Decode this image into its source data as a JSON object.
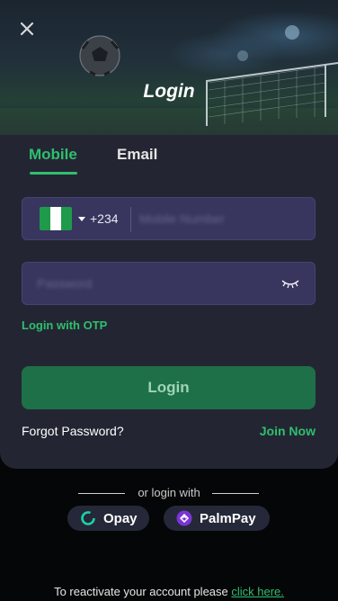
{
  "header": {
    "title": "Login",
    "close_icon": "close-icon"
  },
  "tabs": [
    {
      "label": "Mobile",
      "active": true
    },
    {
      "label": "Email",
      "active": false
    }
  ],
  "phone": {
    "country_flag": "nigeria-flag-icon",
    "country_code": "+234",
    "placeholder": "Mobile Number",
    "value": ""
  },
  "password": {
    "placeholder": "Password",
    "value": "",
    "toggle_icon": "eye-closed-icon"
  },
  "links": {
    "otp": "Login with OTP",
    "forgot": "Forgot Password?",
    "join": "Join Now"
  },
  "login_button": "Login",
  "alt_login": {
    "label": "or login with",
    "providers": [
      {
        "label": "Opay",
        "icon": "opay-icon"
      },
      {
        "label": "PalmPay",
        "icon": "palmpay-icon"
      }
    ]
  },
  "footer": {
    "text": "To reactivate your account please ",
    "link": "click here."
  },
  "colors": {
    "accent": "#2fbf6f",
    "card": "#232632",
    "input_bg": "#38365f",
    "button": "#1e7049",
    "page_bg": "#050607"
  }
}
